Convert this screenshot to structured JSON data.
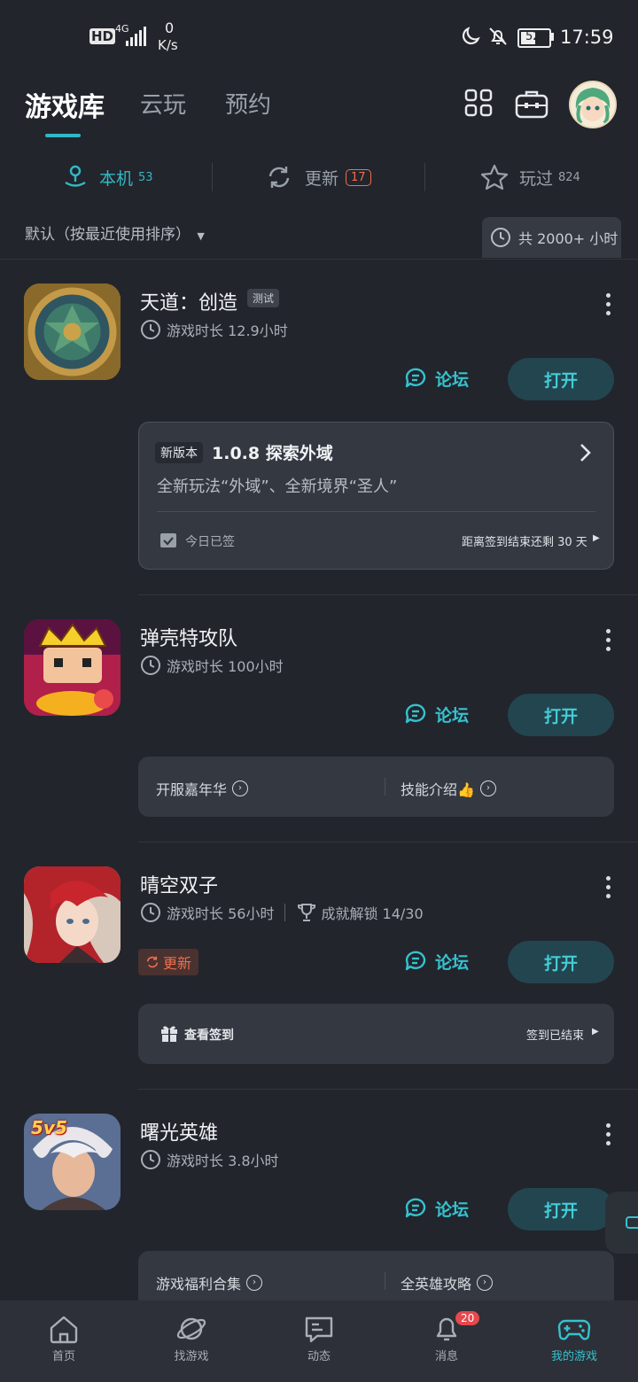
{
  "status_bar": {
    "network": "4G",
    "hd": "HD",
    "speed_value": "0",
    "speed_unit": "K/s",
    "battery": "52",
    "time": "17:59"
  },
  "header": {
    "tabs": [
      "游戏库",
      "云玩",
      "预约"
    ]
  },
  "segments": {
    "local": {
      "label": "本机",
      "count": "53"
    },
    "updates": {
      "label": "更新",
      "count": "17"
    },
    "played": {
      "label": "玩过",
      "count": "824"
    }
  },
  "sort": {
    "label": "默认（按最近使用排序）",
    "total_hours": "共 2000+ 小时"
  },
  "games": [
    {
      "title": "天道：创造",
      "tag": "测试",
      "playtime": "游戏时长 12.9小时",
      "forum": "论坛",
      "open": "打开",
      "version_tag": "新版本",
      "version_title": "1.0.8 探索外域",
      "version_desc": "全新玩法“外域”、全新境界“圣人”",
      "checkin": "今日已签",
      "checkin_remaining": "距离签到结束还剩 30 天"
    },
    {
      "title": "弹壳特攻队",
      "playtime": "游戏时长 100小时",
      "forum": "论坛",
      "open": "打开",
      "link1": "开服嘉年华",
      "link2": "技能介绍👍"
    },
    {
      "title": "晴空双子",
      "playtime": "游戏时长 56小时",
      "achievement": "成就解锁 14/30",
      "update": "更新",
      "forum": "论坛",
      "open": "打开",
      "checkin": "查看签到",
      "checkin_status": "签到已结束"
    },
    {
      "title": "曙光英雄",
      "playtime": "游戏时长 3.8小时",
      "forum": "论坛",
      "open": "打开",
      "icon_text": "5v5",
      "link1": "游戏福利合集",
      "link2": "全英雄攻略"
    }
  ],
  "nav": {
    "items": [
      {
        "label": "首页"
      },
      {
        "label": "找游戏"
      },
      {
        "label": "动态"
      },
      {
        "label": "消息",
        "badge": "20"
      },
      {
        "label": "我的游戏"
      }
    ]
  },
  "colors": {
    "accent": "#35c2cf",
    "update": "#f06e4c",
    "background": "#22252c"
  }
}
